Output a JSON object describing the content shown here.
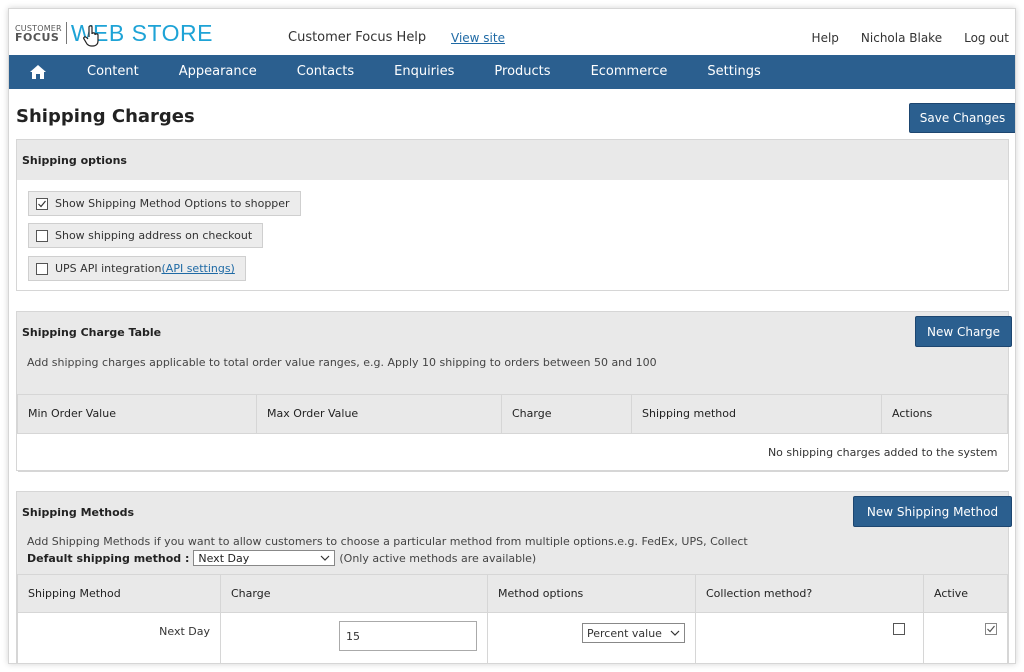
{
  "header": {
    "logo_small_top": "CUSTOMER",
    "logo_small_bottom": "FOCUS",
    "logo_big": "WEB STORE",
    "help_title": "Customer Focus Help",
    "view_site": "View site",
    "links": [
      "Help",
      "Nichola Blake",
      "Log out"
    ]
  },
  "nav": {
    "home_icon": "home-icon",
    "items": [
      "Content",
      "Appearance",
      "Contacts",
      "Enquiries",
      "Products",
      "Ecommerce",
      "Settings"
    ]
  },
  "page": {
    "title": "Shipping Charges",
    "save_label": "Save Changes"
  },
  "shipping_options": {
    "title": "Shipping options",
    "options": [
      {
        "label": "Show Shipping Method Options to shopper",
        "checked": true
      },
      {
        "label": "Show shipping address on checkout",
        "checked": false
      },
      {
        "label": "UPS API integration",
        "checked": false,
        "link": "(API settings)"
      }
    ]
  },
  "charge_table": {
    "title": "Shipping Charge Table",
    "new_label": "New Charge",
    "description": "Add shipping charges applicable to total order value ranges, e.g. Apply 10 shipping to orders between 50 and 100",
    "columns": [
      "Min Order Value",
      "Max Order Value",
      "Charge",
      "Shipping method",
      "Actions"
    ],
    "empty_message": "No shipping charges added to the system"
  },
  "methods": {
    "title": "Shipping Methods",
    "new_label": "New Shipping Method",
    "description": "Add Shipping Methods if you want to allow customers to choose a particular method from multiple options.e.g. FedEx, UPS, Collect",
    "default_label": "Default shipping method :",
    "default_value": "Next Day",
    "default_note": "(Only active methods are available)",
    "columns": [
      "Shipping Method",
      "Charge",
      "Method options",
      "Collection method?",
      "Active"
    ],
    "rows": [
      {
        "name": "Next Day",
        "charge": "15",
        "option": "Percent value",
        "collection": false,
        "active": true
      }
    ]
  },
  "colors": {
    "nav": "#2b5f8f",
    "logo_accent": "#1ea3d6",
    "link": "#1f6aa5"
  }
}
